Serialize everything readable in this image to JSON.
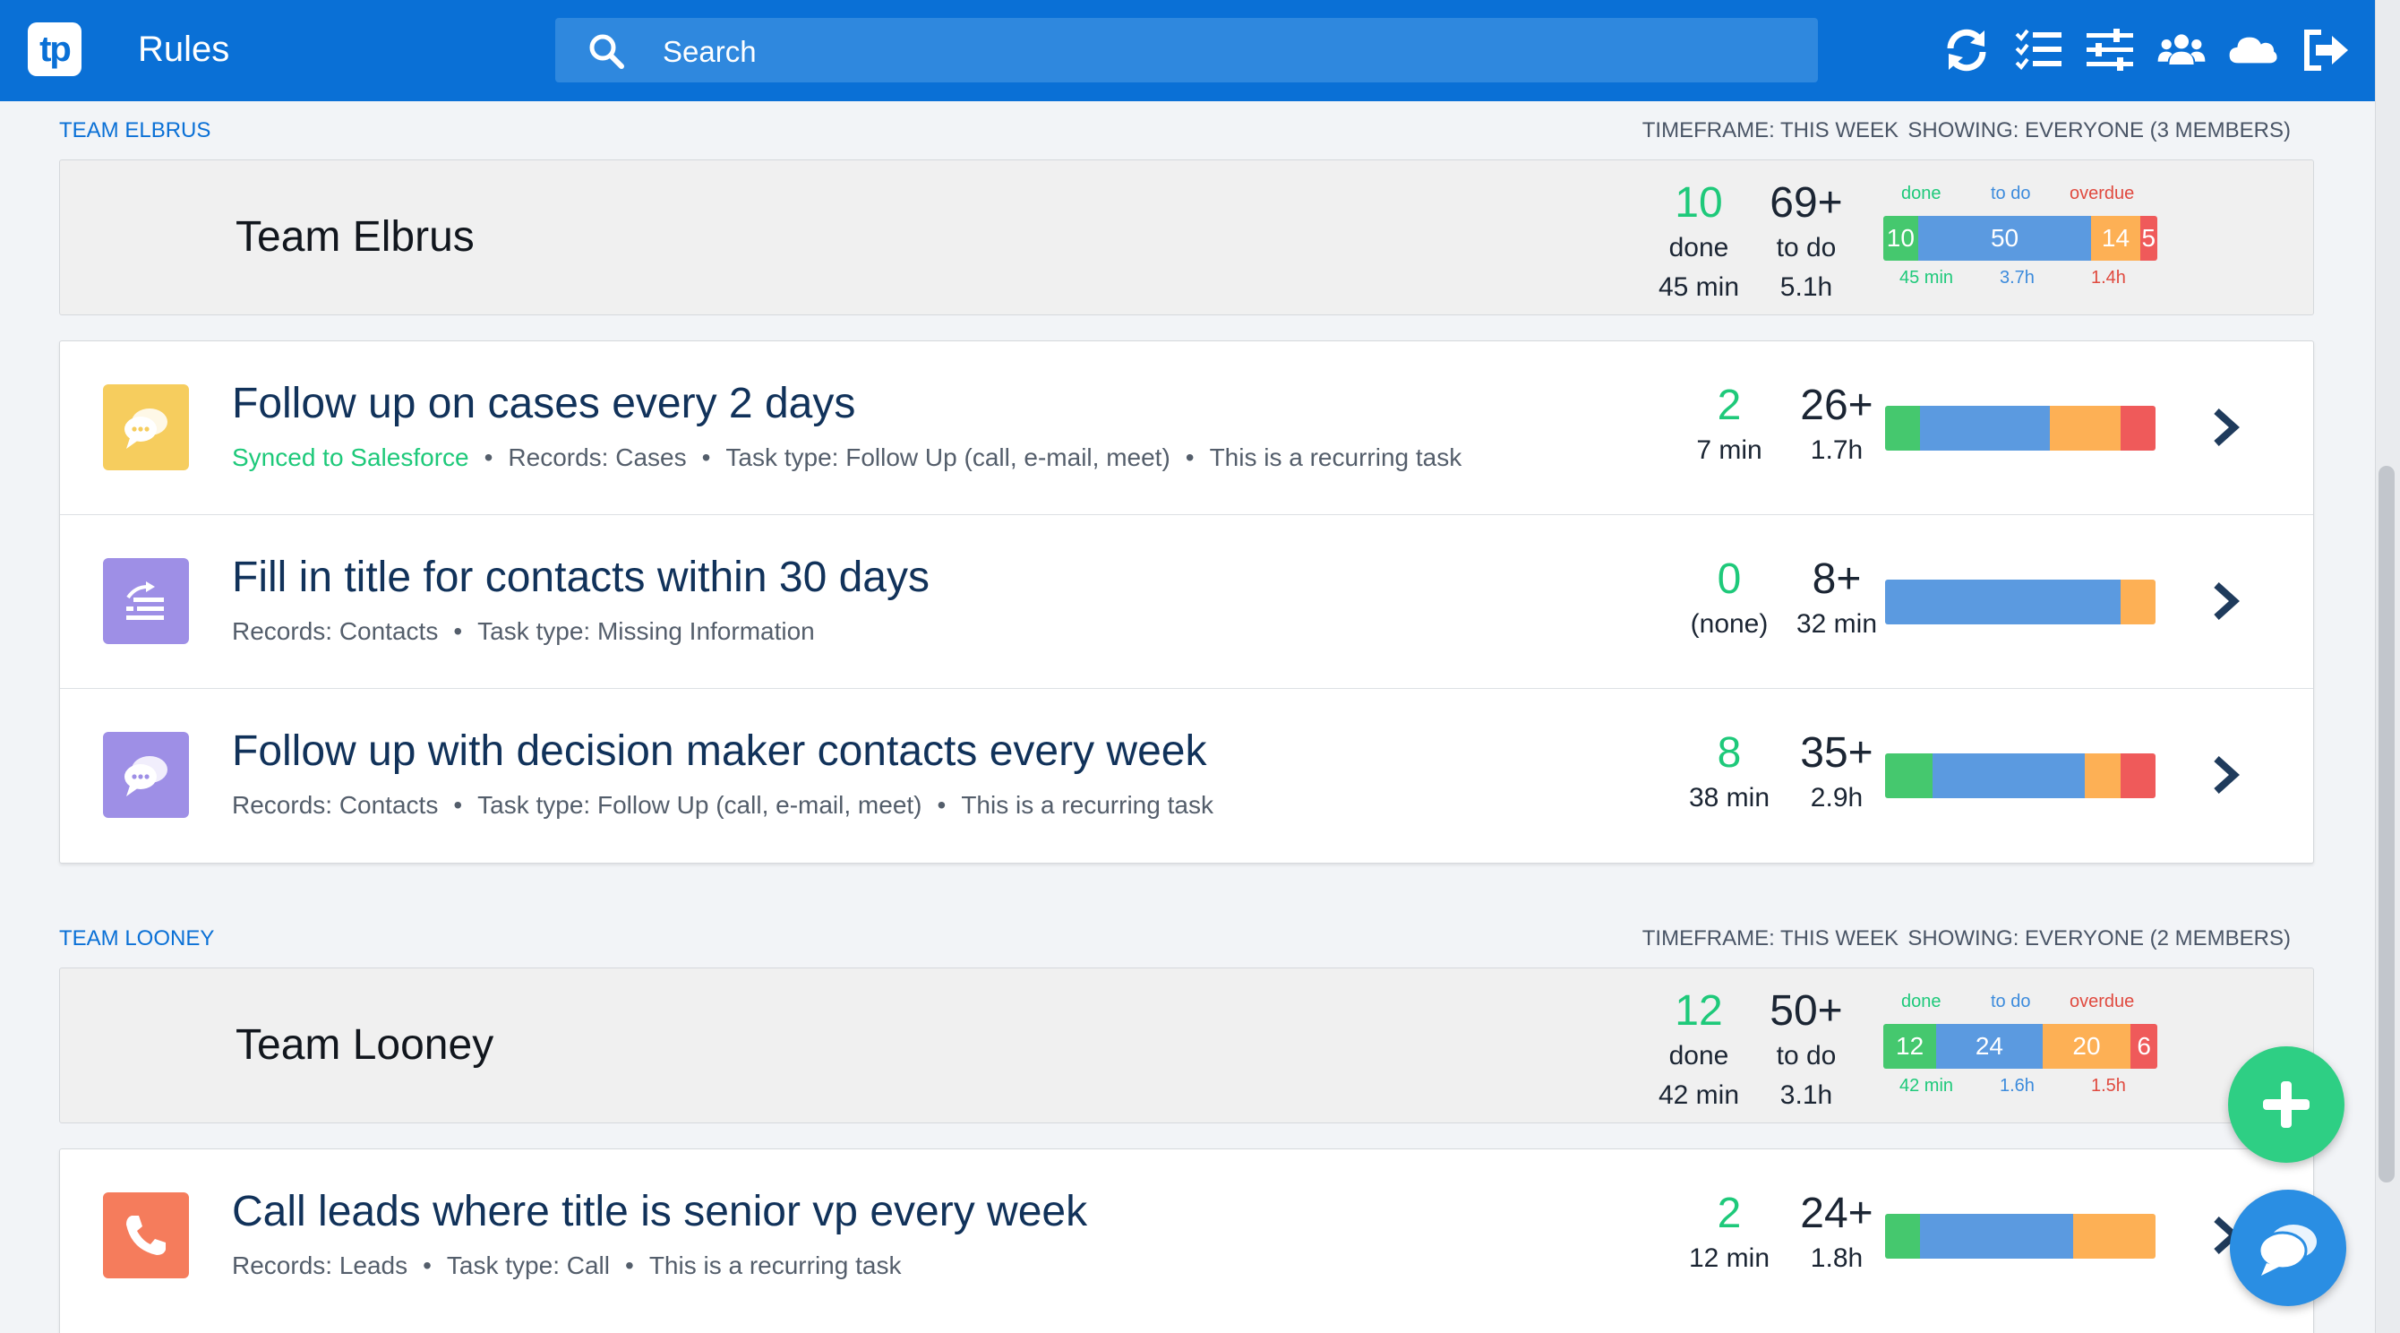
{
  "app": {
    "logo": "tp",
    "title": "Rules"
  },
  "search": {
    "placeholder": "Search"
  },
  "toolbar_icons": [
    "sync-icon",
    "checklist-icon",
    "sliders-icon",
    "users-icon",
    "cloud-icon",
    "sign-out-icon"
  ],
  "colors": {
    "brand": "#0a70d6",
    "done": "#45c86e",
    "todo": "#5b9ae0",
    "due": "#fdb055",
    "overdue": "#ef5a5a",
    "synced": "#1ec97a"
  },
  "legend": {
    "done": "done",
    "todo": "to do",
    "overdue": "overdue"
  },
  "teams": [
    {
      "section_label": "TEAM ELBRUS",
      "timeframe": "TIMEFRAME: THIS WEEK",
      "showing": "SHOWING: EVERYONE (3 MEMBERS)",
      "name": "Team Elbrus",
      "done_count": "10",
      "done_label": "done",
      "done_time": "45 min",
      "todo_count": "69+",
      "todo_label": "to do",
      "todo_time": "5.1h",
      "bar": [
        {
          "kind": "done",
          "value": 10,
          "label": "10"
        },
        {
          "kind": "todo",
          "value": 50,
          "label": "50"
        },
        {
          "kind": "due",
          "value": 14,
          "label": "14"
        },
        {
          "kind": "overdue",
          "value": 5,
          "label": "5"
        }
      ],
      "bar_times": {
        "done": "45 min",
        "todo": "3.7h",
        "overdue": "1.4h"
      },
      "rules": [
        {
          "icon": "chat-bubbles-icon",
          "icon_color": "#f6cd5e",
          "title": "Follow up on cases every 2 days",
          "synced": "Synced to Salesforce",
          "meta": [
            "Records: Cases",
            "Task type: Follow Up (call, e-mail, meet)",
            "This is a recurring task"
          ],
          "done_count": "2",
          "done_time": "7 min",
          "todo_count": "26+",
          "todo_time": "1.7h",
          "bar": [
            {
              "kind": "done",
              "value": 3
            },
            {
              "kind": "todo",
              "value": 11
            },
            {
              "kind": "due",
              "value": 6
            },
            {
              "kind": "overdue",
              "value": 3
            }
          ]
        },
        {
          "icon": "edit-list-icon",
          "icon_color": "#9e8fe6",
          "title": "Fill in title for contacts within 30 days",
          "synced": "",
          "meta": [
            "Records: Contacts",
            "Task type: Missing Information"
          ],
          "done_count": "0",
          "done_time": "(none)",
          "todo_count": "8+",
          "todo_time": "32 min",
          "bar": [
            {
              "kind": "todo",
              "value": 20
            },
            {
              "kind": "due",
              "value": 3
            }
          ]
        },
        {
          "icon": "chat-bubbles-icon",
          "icon_color": "#9e8fe6",
          "title": "Follow up with decision maker contacts every week",
          "synced": "",
          "meta": [
            "Records: Contacts",
            "Task type: Follow Up (call, e-mail, meet)",
            "This is a recurring task"
          ],
          "done_count": "8",
          "done_time": "38 min",
          "todo_count": "35+",
          "todo_time": "2.9h",
          "bar": [
            {
              "kind": "done",
              "value": 4
            },
            {
              "kind": "todo",
              "value": 13
            },
            {
              "kind": "due",
              "value": 3
            },
            {
              "kind": "overdue",
              "value": 3
            }
          ]
        }
      ]
    },
    {
      "section_label": "TEAM LOONEY",
      "timeframe": "TIMEFRAME: THIS WEEK",
      "showing": "SHOWING: EVERYONE (2 MEMBERS)",
      "name": "Team Looney",
      "done_count": "12",
      "done_label": "done",
      "done_time": "42 min",
      "todo_count": "50+",
      "todo_label": "to do",
      "todo_time": "3.1h",
      "bar": [
        {
          "kind": "done",
          "value": 12,
          "label": "12"
        },
        {
          "kind": "todo",
          "value": 24,
          "label": "24"
        },
        {
          "kind": "due",
          "value": 20,
          "label": "20"
        },
        {
          "kind": "overdue",
          "value": 6,
          "label": "6"
        }
      ],
      "bar_times": {
        "done": "42 min",
        "todo": "1.6h",
        "overdue": "1.5h"
      },
      "rules": [
        {
          "icon": "phone-icon",
          "icon_color": "#f57c5c",
          "title": "Call leads where title is senior vp every week",
          "synced": "",
          "meta": [
            "Records: Leads",
            "Task type: Call",
            "This is a recurring task"
          ],
          "done_count": "2",
          "done_time": "12 min",
          "todo_count": "24+",
          "todo_time": "1.8h",
          "bar": [
            {
              "kind": "done",
              "value": 3
            },
            {
              "kind": "todo",
              "value": 13
            },
            {
              "kind": "due",
              "value": 7
            }
          ]
        }
      ]
    }
  ]
}
